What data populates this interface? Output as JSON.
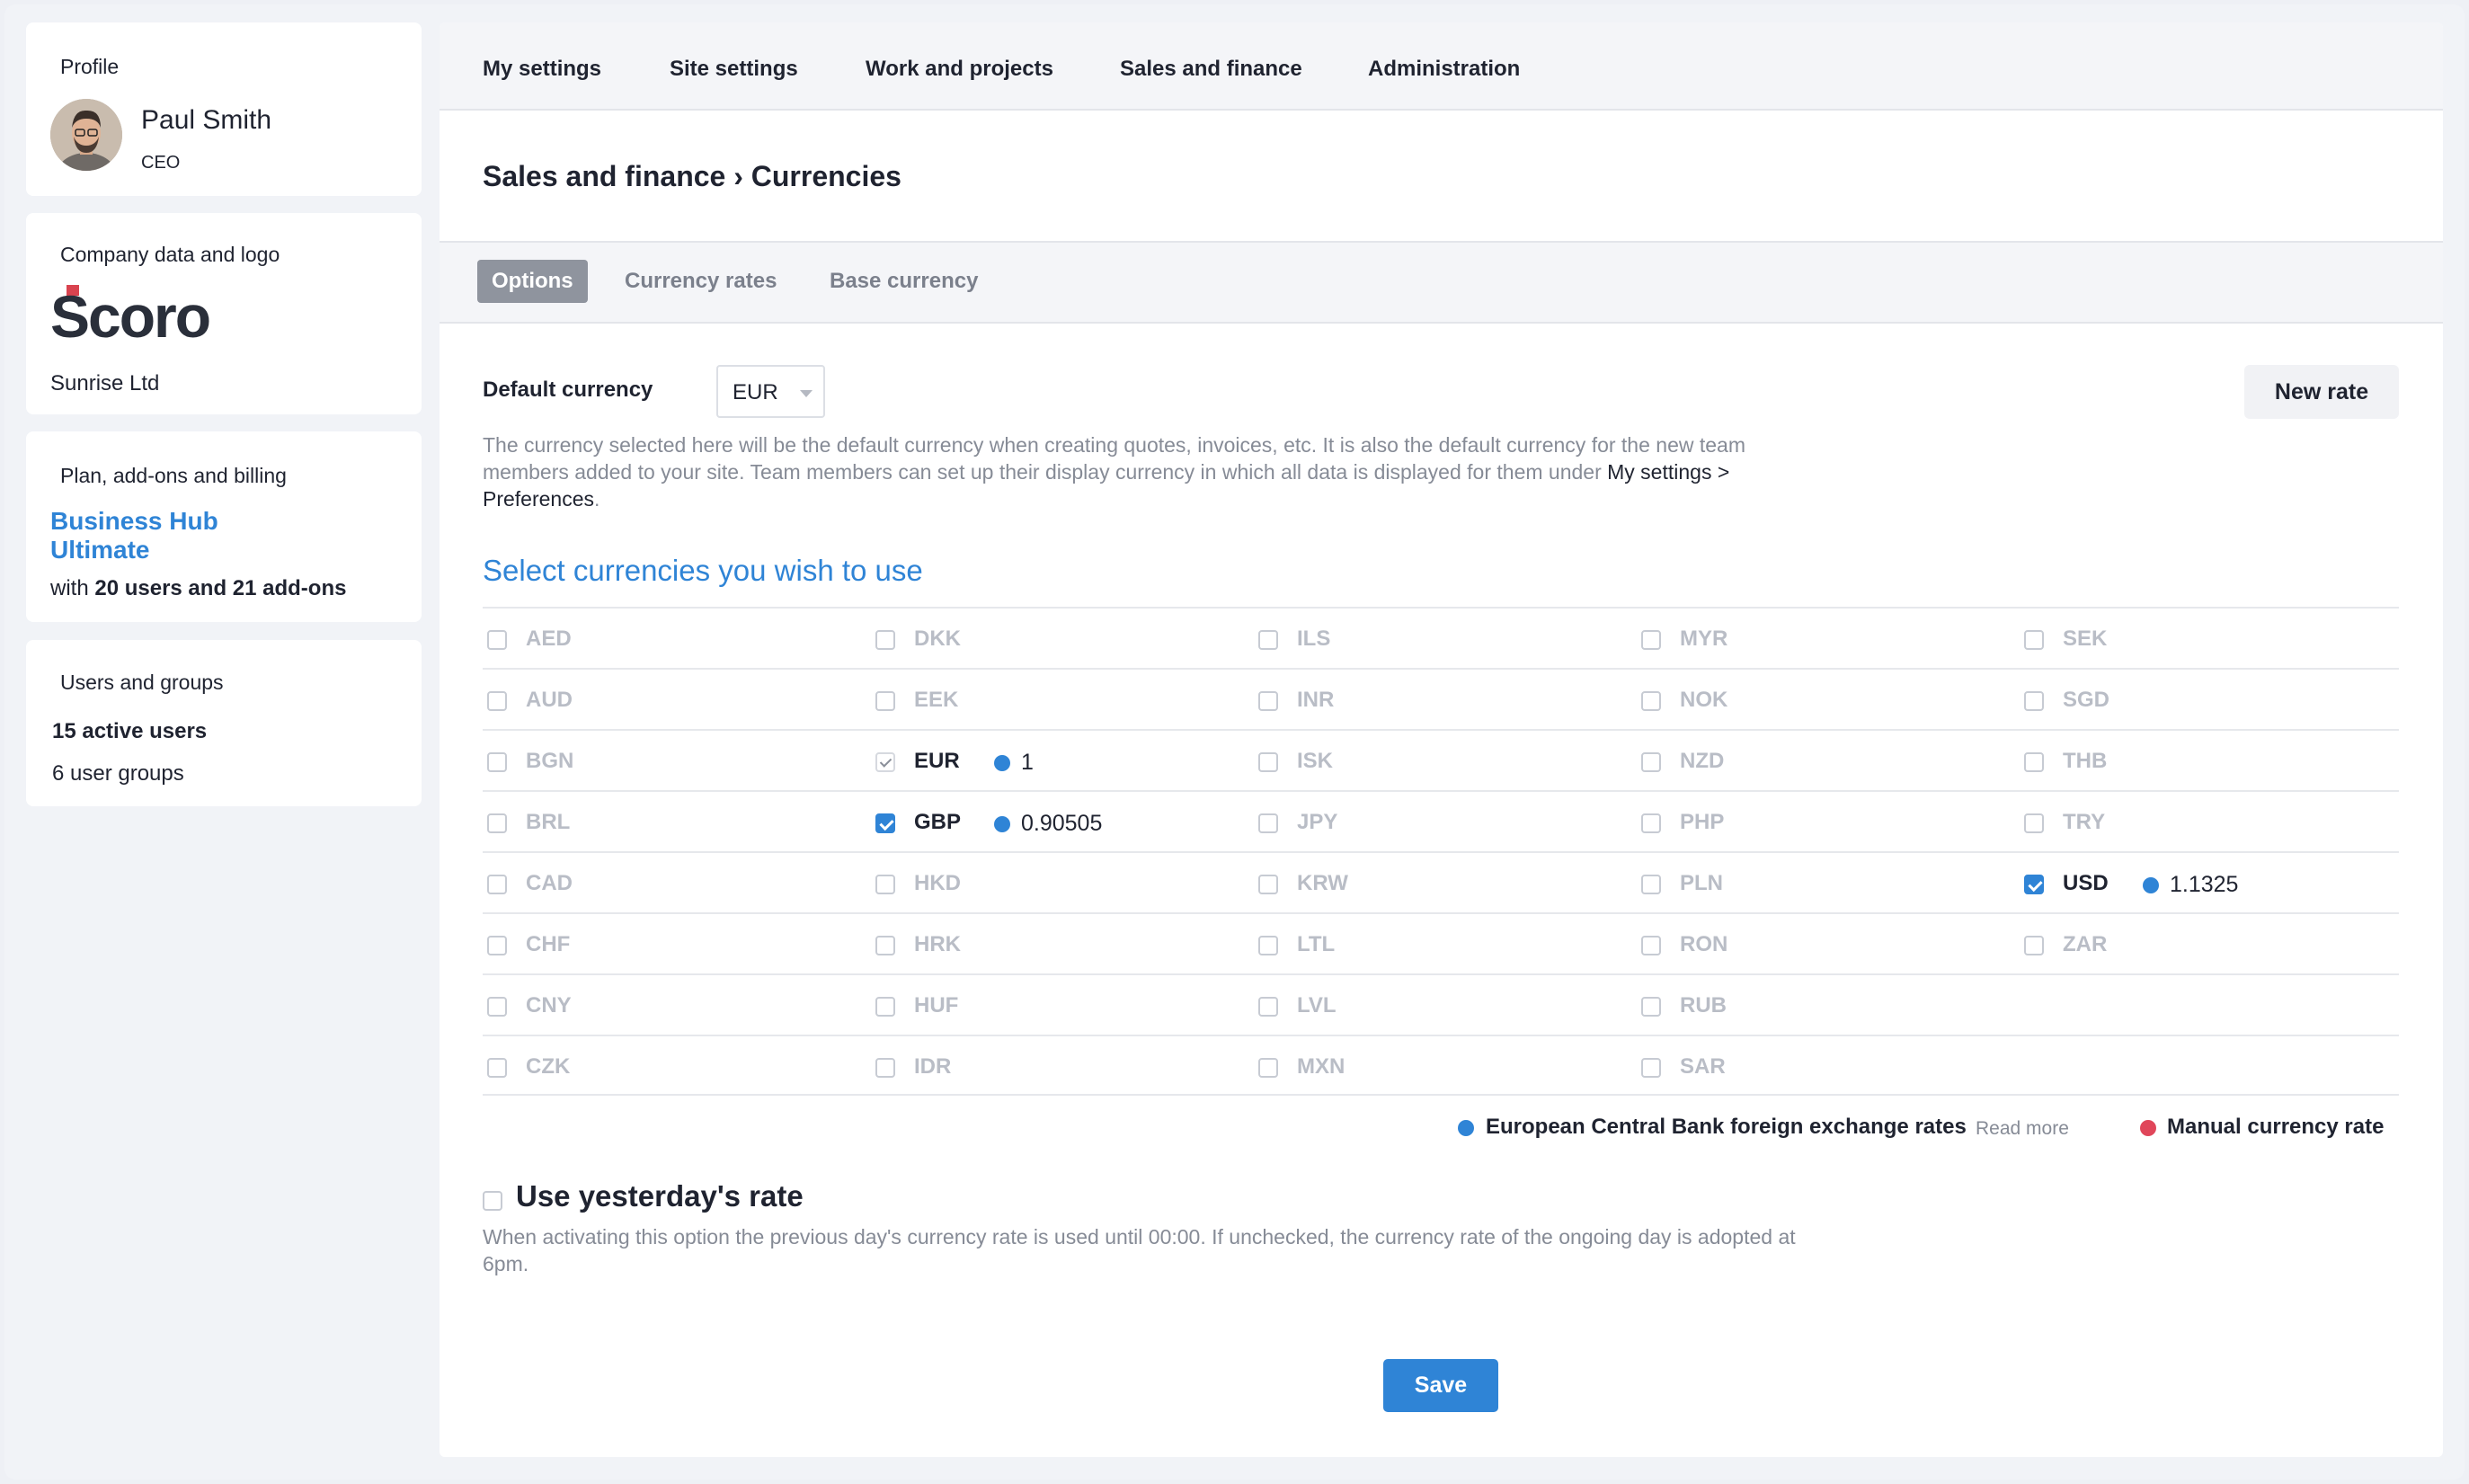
{
  "sidebar": {
    "profile": {
      "title": "Profile",
      "name": "Paul Smith",
      "role": "CEO"
    },
    "company": {
      "title": "Company data and logo",
      "logo_text": "Scoro",
      "name": "Sunrise Ltd"
    },
    "plan": {
      "title": "Plan, add-ons and billing",
      "name": "Business Hub Ultimate",
      "desc_prefix": "with ",
      "desc_users": "20 users and 21 add-ons"
    },
    "users": {
      "title": "Users and groups",
      "active": "15 active users",
      "groups": "6 user groups"
    }
  },
  "topnav": [
    "My settings",
    "Site settings",
    "Work and projects",
    "Sales and finance",
    "Administration"
  ],
  "breadcrumb": "Sales and finance › Currencies",
  "tabs": [
    "Options",
    "Currency rates",
    "Base currency"
  ],
  "active_tab": "Options",
  "default_currency": {
    "label": "Default currency",
    "value": "EUR"
  },
  "new_rate_button": "New rate",
  "help_text_1": "The currency selected here will be the default currency when creating quotes, invoices, etc. It is also the default currency for the new team members added to your site. Team members can set up their display currency in which all data is displayed for them under ",
  "help_link": "My settings > Preferences",
  "help_text_2": ".",
  "section_title": "Select currencies you wish to use",
  "currencies": [
    [
      "AED",
      "DKK",
      "ILS",
      "MYR",
      "SEK"
    ],
    [
      "AUD",
      "EEK",
      "INR",
      "NOK",
      "SGD"
    ],
    [
      "BGN",
      "EUR",
      "ISK",
      "NZD",
      "THB"
    ],
    [
      "BRL",
      "GBP",
      "JPY",
      "PHP",
      "TRY"
    ],
    [
      "CAD",
      "HKD",
      "KRW",
      "PLN",
      "USD"
    ],
    [
      "CHF",
      "HRK",
      "LTL",
      "RON",
      "ZAR"
    ],
    [
      "CNY",
      "HUF",
      "LVL",
      "RUB",
      ""
    ],
    [
      "CZK",
      "IDR",
      "MXN",
      "SAR",
      ""
    ]
  ],
  "selected": {
    "EUR": {
      "rate": "1",
      "state": "locked"
    },
    "GBP": {
      "rate": "0.90505",
      "state": "checked"
    },
    "USD": {
      "rate": "1.1325",
      "state": "checked"
    }
  },
  "legend": {
    "ecb": "European Central Bank foreign exchange rates",
    "read_more": "Read more",
    "manual": "Manual currency rate",
    "ecb_color": "#2f84d6",
    "manual_color": "#e0465a"
  },
  "yesterday": {
    "title": "Use yesterday's rate",
    "desc": "When activating this option the previous day's currency rate is used until 00:00. If unchecked, the currency rate of the ongoing day is adopted at 6pm."
  },
  "save_button": "Save"
}
